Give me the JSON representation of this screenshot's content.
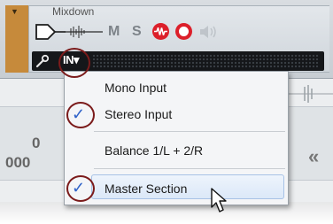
{
  "track": {
    "name": "Mixdown",
    "mute_label": "M",
    "solo_label": "S",
    "input_button_label": "IN▾"
  },
  "icons": {
    "collapse": "triangle-down-icon",
    "track_type": "audio-output-icon",
    "record_monitor": "waveform-icon",
    "record": "record-icon",
    "speaker": "speaker-icon",
    "settings": "wrench-icon",
    "rewind": "rewind-icon",
    "cursor": "mouse-pointer-icon",
    "check": "checkmark-icon"
  },
  "timeline": {
    "time_top": "0",
    "time_bottom": "000",
    "rewind_glyph": "«"
  },
  "context_menu": {
    "items": [
      {
        "label": "Mono Input",
        "checked": false
      },
      {
        "label": "Stereo Input",
        "checked": true
      },
      {
        "label": "Balance 1/L + 2/R",
        "checked": false
      },
      {
        "label": "Master Section",
        "checked": true,
        "hovered": true
      }
    ],
    "check_glyph": "✓"
  },
  "colors": {
    "track_color": "#c68a3b",
    "record_red": "#dc1f2a",
    "check_blue": "#2f62c9",
    "annotation": "#7b1b1b"
  }
}
